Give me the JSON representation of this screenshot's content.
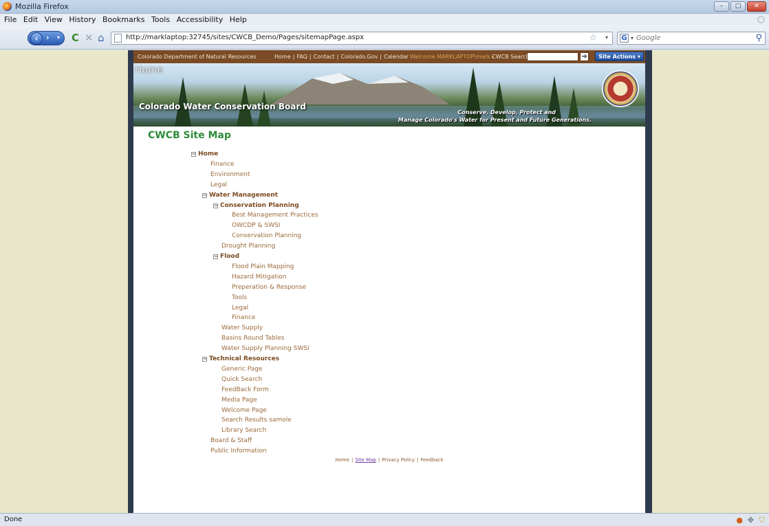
{
  "window": {
    "title": "Mozilla Firefox",
    "buttons": [
      "–",
      "□",
      "✕"
    ]
  },
  "menu": [
    "File",
    "Edit",
    "View",
    "History",
    "Bookmarks",
    "Tools",
    "Accessibility",
    "Help"
  ],
  "nav": {
    "url": "http://marklaptop:32745/sites/CWCB_Demo/Pages/sitemapPage.aspx",
    "search_placeholder": "Google",
    "search_engine_letter": "G"
  },
  "site": {
    "org": "Colorado Department of Natural Resources",
    "links": [
      "Home",
      "FAQ",
      "Contact",
      "Colorado.Gov",
      "Calendar"
    ],
    "welcome": "Welcome MARKLAPTOP\\mark",
    "search_label": "CWCB Search",
    "site_actions": "Site Actions ▾"
  },
  "banner": {
    "home": "Home",
    "title": "Colorado Water Conservation Board",
    "tagline1": "Conserve, Develop, Protect and",
    "tagline2": "Manage Colorado's Water for Present and Future Generations."
  },
  "sitemap": {
    "title": "CWCB Site Map",
    "items": [
      {
        "label": "Home",
        "level": 0,
        "toggle": true
      },
      {
        "label": "Finance",
        "level": 1,
        "toggle": false
      },
      {
        "label": "Environment",
        "level": 1,
        "toggle": false
      },
      {
        "label": "Legal",
        "level": 1,
        "toggle": false
      },
      {
        "label": "Water Management",
        "level": 1,
        "toggle": true
      },
      {
        "label": "Conservation Planning",
        "level": 2,
        "toggle": true
      },
      {
        "label": "Best Management Practices",
        "level": 3,
        "toggle": false
      },
      {
        "label": "OWCDP & SWSI",
        "level": 3,
        "toggle": false
      },
      {
        "label": "Conservation Planning",
        "level": 3,
        "toggle": false
      },
      {
        "label": "Drought Planning",
        "level": 2,
        "toggle": false
      },
      {
        "label": "Flood",
        "level": 2,
        "toggle": true
      },
      {
        "label": "Flood Plain Mapping",
        "level": 3,
        "toggle": false
      },
      {
        "label": "Hazard Mitigation",
        "level": 3,
        "toggle": false
      },
      {
        "label": "Preperation & Response",
        "level": 3,
        "toggle": false
      },
      {
        "label": "Tools",
        "level": 3,
        "toggle": false
      },
      {
        "label": "Legal",
        "level": 3,
        "toggle": false
      },
      {
        "label": "Finance",
        "level": 3,
        "toggle": false
      },
      {
        "label": "Water Supply",
        "level": 2,
        "toggle": false
      },
      {
        "label": "Basins Round Tables",
        "level": 2,
        "toggle": false
      },
      {
        "label": "Water Supply Planning SWSI",
        "level": 2,
        "toggle": false
      },
      {
        "label": "Technical Resources",
        "level": 1,
        "toggle": true
      },
      {
        "label": "Generic Page",
        "level": 2,
        "toggle": false
      },
      {
        "label": "Quick Search",
        "level": 2,
        "toggle": false
      },
      {
        "label": "FeedBack Form",
        "level": 2,
        "toggle": false
      },
      {
        "label": "Media Page",
        "level": 2,
        "toggle": false
      },
      {
        "label": "Welcome Page",
        "level": 2,
        "toggle": false
      },
      {
        "label": "Search Results samole",
        "level": 2,
        "toggle": false
      },
      {
        "label": "Library Search",
        "level": 2,
        "toggle": false
      },
      {
        "label": "Board & Staff",
        "level": 1,
        "toggle": false
      },
      {
        "label": "Public Information",
        "level": 1,
        "toggle": false
      }
    ]
  },
  "footer": {
    "links": [
      {
        "label": "Home",
        "active": false
      },
      {
        "label": "Site Map",
        "active": true
      },
      {
        "label": "Privacy Policy",
        "active": false
      },
      {
        "label": "Feedback",
        "active": false
      }
    ]
  },
  "status": {
    "text": "Done"
  }
}
